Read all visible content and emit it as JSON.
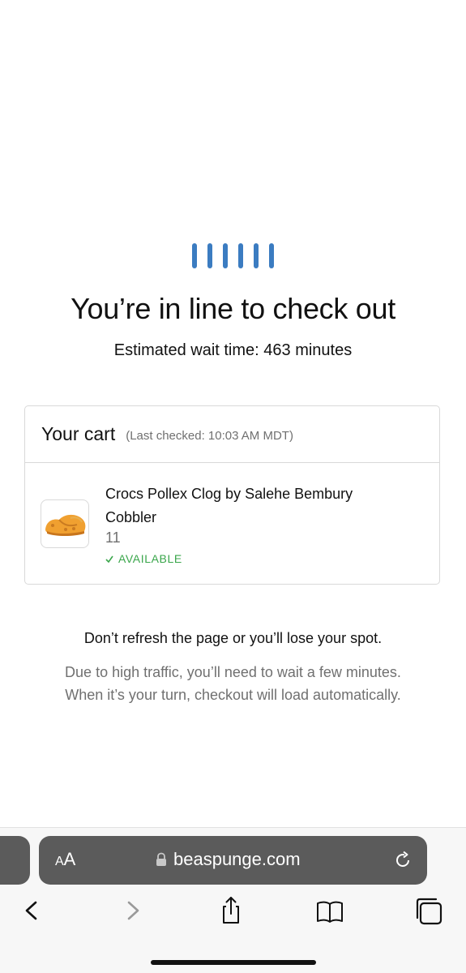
{
  "queue": {
    "title": "You’re in line to check out",
    "wait_time": "Estimated wait time: 463 minutes"
  },
  "cart": {
    "title": "Your cart",
    "last_checked": "(Last checked: 10:03 AM MDT)",
    "items": [
      {
        "name": "Crocs Pollex Clog by Salehe Bembury Cobbler",
        "size": "11",
        "status": "AVAILABLE",
        "status_icon": "check-icon",
        "image_icon": "clog-shoe-icon"
      }
    ]
  },
  "notice": {
    "warning": "Don’t refresh the page or you’ll lose your spot.",
    "line1": "Due to high traffic, you’ll need to wait a few minutes.",
    "line2": "When it’s your turn, checkout will load automatically."
  },
  "browser": {
    "text_size_label_small": "A",
    "text_size_label_large": "A",
    "url": "beaspunge.com",
    "toolbar_icons": [
      "back-icon",
      "forward-icon",
      "share-icon",
      "bookmarks-icon",
      "tabs-icon"
    ]
  },
  "colors": {
    "loader_blue": "#3b7cc1",
    "available_green": "#3aa64b",
    "address_bar_gray": "#5b5b5b",
    "muted_text": "#707070"
  }
}
